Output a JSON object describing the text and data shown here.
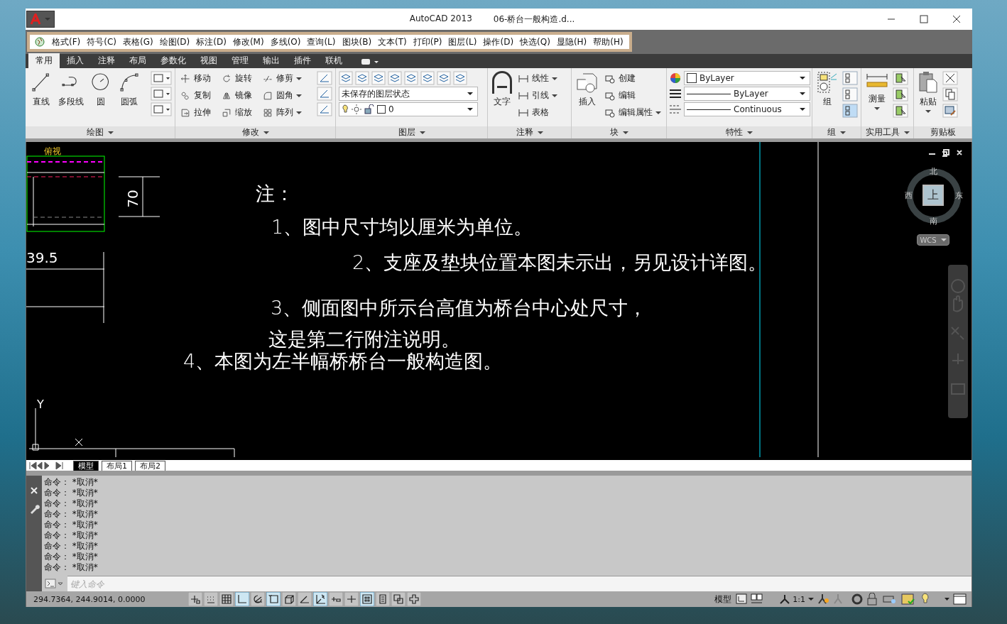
{
  "window": {
    "title": "AutoCAD 2013",
    "document": "06-桥台一般构造.d..."
  },
  "menu_bar": [
    "格式(F)",
    "符号(C)",
    "表格(G)",
    "绘图(D)",
    "标注(D)",
    "修改(M)",
    "多线(O)",
    "查询(L)",
    "图块(B)",
    "文本(T)",
    "打印(P)",
    "图层(L)",
    "操作(D)",
    "快选(Q)",
    "显隐(H)",
    "帮助(H)"
  ],
  "ribbon_tabs": [
    {
      "label": "常用",
      "selected": true
    },
    {
      "label": "插入",
      "selected": false
    },
    {
      "label": "注释",
      "selected": false
    },
    {
      "label": "布局",
      "selected": false
    },
    {
      "label": "参数化",
      "selected": false
    },
    {
      "label": "视图",
      "selected": false
    },
    {
      "label": "管理",
      "selected": false
    },
    {
      "label": "输出",
      "selected": false
    },
    {
      "label": "插件",
      "selected": false
    },
    {
      "label": "联机",
      "selected": false
    }
  ],
  "draw_panel": {
    "title": "绘图",
    "tools": [
      "直线",
      "多段线",
      "圆",
      "圆弧"
    ]
  },
  "modify_panel": {
    "title": "修改",
    "tools": [
      "移动",
      "旋转",
      "修剪",
      "复制",
      "镜像",
      "圆角",
      "拉伸",
      "缩放",
      "阵列"
    ]
  },
  "layer_panel": {
    "title": "图层",
    "layer_state": "未保存的图层状态",
    "current_layer": "0"
  },
  "annotation_panel": {
    "title": "注释",
    "large_tool": "文字",
    "tools": [
      "线性",
      "引线",
      "表格"
    ]
  },
  "block_panel": {
    "title": "块",
    "large_tool": "插入",
    "tools": [
      "创建",
      "编辑",
      "编辑属性"
    ]
  },
  "properties_panel": {
    "title": "特性",
    "color_setting": "ByLayer",
    "lineweight": "ByLayer",
    "linetype": "Continuous"
  },
  "group_panel": {
    "title": "组",
    "large_tool": "组"
  },
  "utilities_panel": {
    "title": "实用工具",
    "large_tool": "测量"
  },
  "clipboard_panel": {
    "title": "剪贴板",
    "large_tool": "粘贴"
  },
  "drawing": {
    "viewport_label": "俯视",
    "dimension_labels": [
      "70",
      "39.5"
    ],
    "ucs_label": "Y",
    "notes": [
      "注：",
      "1、图中尺寸均以厘米为单位。",
      "2、支座及垫块位置本图未示出，另见设计详图。",
      "3、侧面图中所示台高值为桥台中心处尺寸，",
      "这是第二行附注说明。",
      "4、本图为左半幅桥桥台一般构造图。"
    ]
  },
  "viewcube": {
    "north": "北",
    "south": "南",
    "west": "西",
    "east": "东",
    "face": "上",
    "coordinate_system": "WCS"
  },
  "layout_tabs": [
    {
      "label": "模型",
      "selected": true
    },
    {
      "label": "布局1",
      "selected": false
    },
    {
      "label": "布局2",
      "selected": false
    }
  ],
  "command_history": [
    "命令： *取消*",
    "命令： *取消*",
    "命令： *取消*",
    "命令： *取消*",
    "命令： *取消*",
    "命令： *取消*",
    "命令： *取消*",
    "命令： *取消*",
    "命令： *取消*"
  ],
  "command_line": {
    "placeholder": "键入命令"
  },
  "status_bar": {
    "coordinates": "294.7364, 244.9014, 0.0000",
    "toggles": [
      {
        "kind": "infer",
        "on": false
      },
      {
        "kind": "snap",
        "on": false
      },
      {
        "kind": "grid",
        "on": false
      },
      {
        "kind": "ortho",
        "on": true
      },
      {
        "kind": "polar",
        "on": false
      },
      {
        "kind": "osnap",
        "on": true
      },
      {
        "kind": "osnap3d",
        "on": false
      },
      {
        "kind": "otrack",
        "on": false
      },
      {
        "kind": "ducs",
        "on": true
      },
      {
        "kind": "dyn",
        "on": false
      },
      {
        "kind": "lineweight",
        "on": false
      },
      {
        "kind": "transparency",
        "on": true
      },
      {
        "kind": "quickprops",
        "on": false
      },
      {
        "kind": "selcycle",
        "on": false
      },
      {
        "kind": "monitor",
        "on": false
      }
    ],
    "space": "模型",
    "annotation_scale": "1:1"
  }
}
